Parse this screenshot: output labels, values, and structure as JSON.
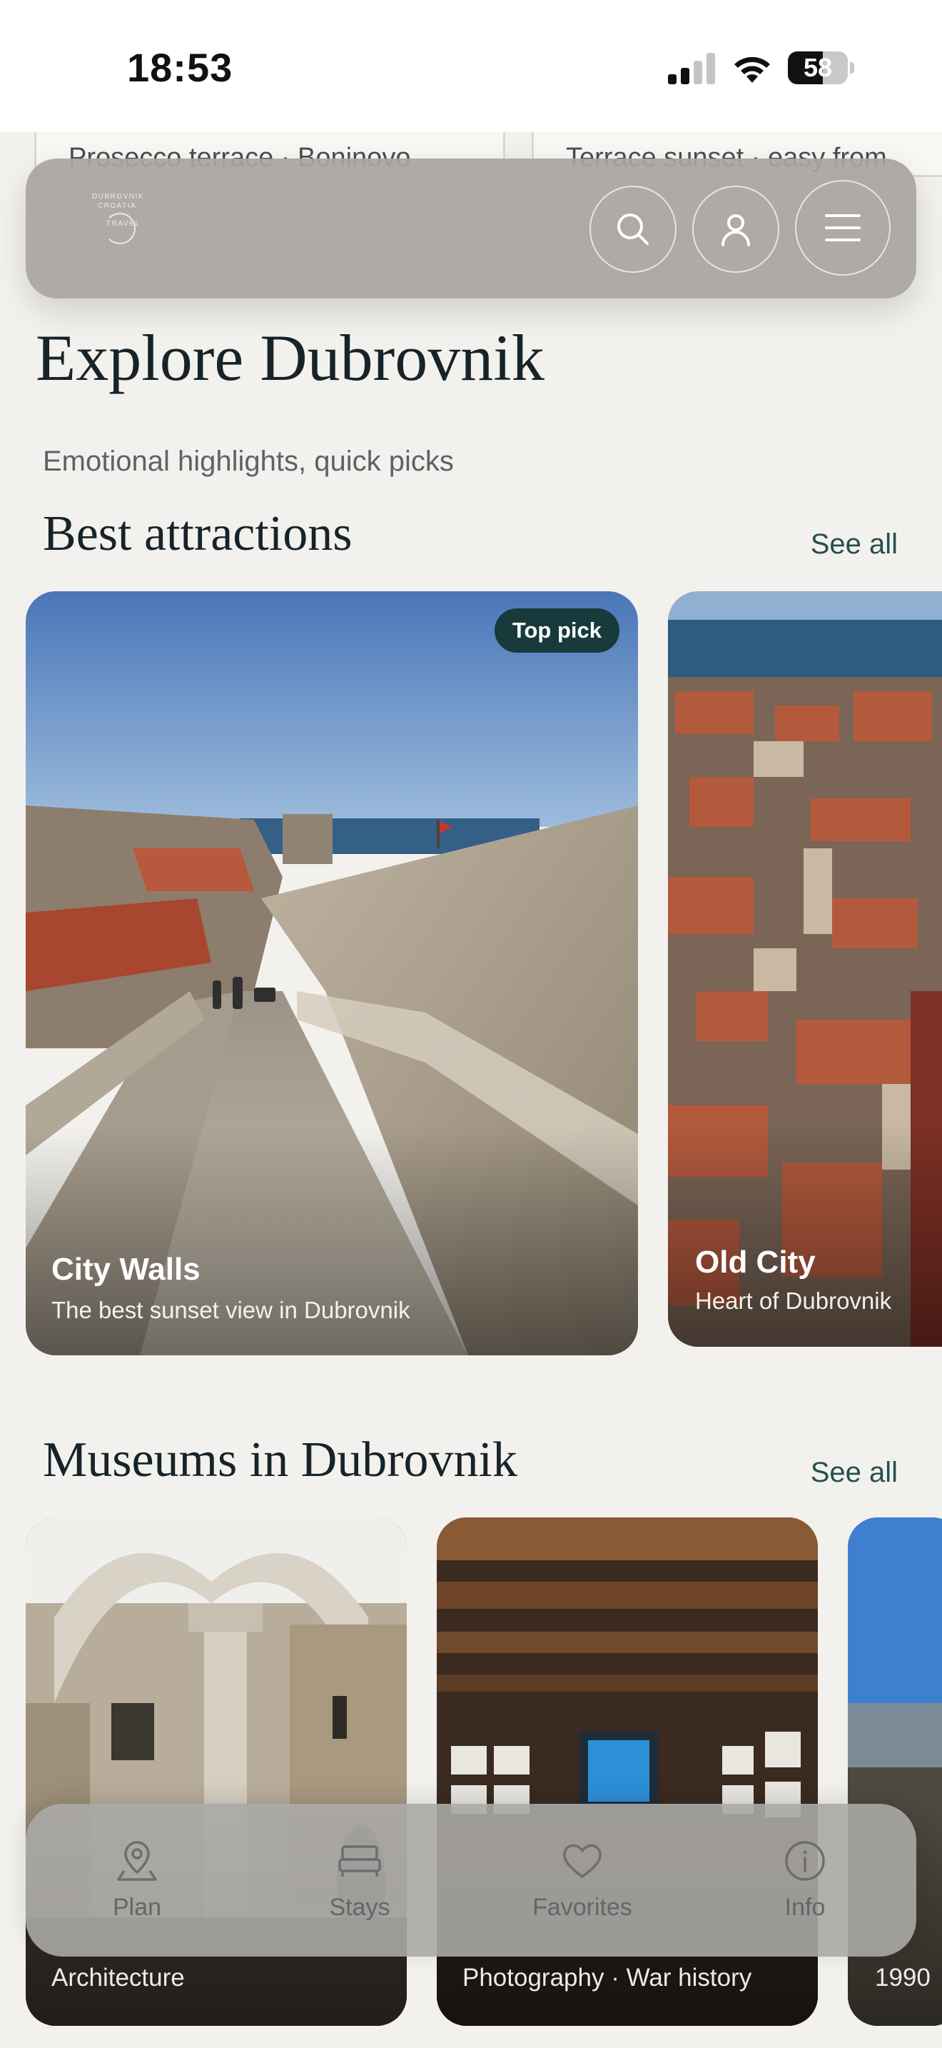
{
  "status_bar": {
    "time": "18:53",
    "battery": "58",
    "battery_level": 0.58
  },
  "peek_cards": [
    "Prosecco terrace · Boninovo",
    "Terrace sunset · easy from"
  ],
  "header": {
    "logo": {
      "line1": "DUBROVNIK",
      "line2": "CROATIA",
      "line3": "TRAVEL"
    },
    "icons": {
      "search": "search-icon",
      "account": "user-icon",
      "menu": "menu-icon"
    }
  },
  "page": {
    "title": "Explore Dubrovnik",
    "subtitle": "Emotional highlights, quick picks"
  },
  "attractions": {
    "title": "Best attractions",
    "see_all": "See all",
    "cards": [
      {
        "title": "City Walls",
        "subtitle": "The best sunset view in Dubrovnik",
        "badge": "Top pick"
      },
      {
        "title": "Old City",
        "subtitle": "Heart of Dubrovnik"
      }
    ]
  },
  "museums": {
    "title": "Museums in Dubrovnik",
    "see_all": "See all",
    "cards": [
      {
        "subtitle": "Architecture"
      },
      {
        "subtitle": "Photography · War history"
      },
      {
        "subtitle": "1990"
      }
    ]
  },
  "bottom_nav": [
    {
      "label": "Plan",
      "icon": "map-pin-icon"
    },
    {
      "label": "Stays",
      "icon": "bed-icon"
    },
    {
      "label": "Favorites",
      "icon": "heart-icon"
    },
    {
      "label": "Info",
      "icon": "info-icon"
    }
  ],
  "colors": {
    "background": "#f3f1ed",
    "accent": "#24504f",
    "badge": "#173a3b",
    "text": "#17232a"
  }
}
